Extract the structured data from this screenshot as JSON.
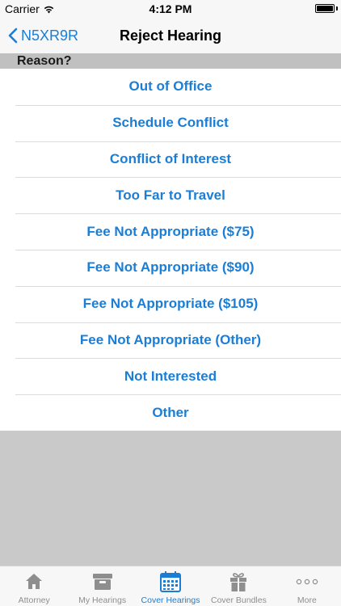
{
  "status": {
    "carrier": "Carrier",
    "time": "4:12 PM"
  },
  "nav": {
    "back_label": "N5XR9R",
    "title": "Reject Hearing"
  },
  "section": {
    "header": "Reason?"
  },
  "options": [
    "Out of Office",
    "Schedule Conflict",
    "Conflict of Interest",
    "Too Far to Travel",
    "Fee Not Appropriate ($75)",
    "Fee Not Appropriate ($90)",
    "Fee Not Appropriate ($105)",
    "Fee Not Appropriate (Other)",
    "Not Interested",
    "Other"
  ],
  "tabs": [
    {
      "label": "Attorney",
      "icon": "house-icon"
    },
    {
      "label": "My Hearings",
      "icon": "archive-box-icon"
    },
    {
      "label": "Cover Hearings",
      "icon": "calendar-icon",
      "active": true
    },
    {
      "label": "Cover Bundles",
      "icon": "gift-icon"
    },
    {
      "label": "More",
      "icon": "more-dots-icon"
    }
  ],
  "colors": {
    "accent": "#1a7ed6",
    "inactive_tab": "#8e8e8e",
    "background": "#c9c9c9"
  }
}
